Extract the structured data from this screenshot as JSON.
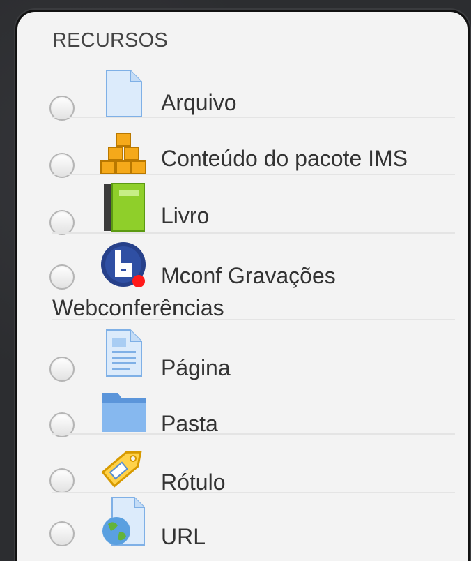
{
  "section": {
    "heading": "RECURSOS"
  },
  "options": [
    {
      "label": "Arquivo",
      "icon": "file-icon"
    },
    {
      "label": "Conteúdo do pacote IMS",
      "icon": "ims-package-icon"
    },
    {
      "label": "Livro",
      "icon": "book-icon"
    },
    {
      "label": "Mconf Gravações",
      "label_continued": "Webconferências",
      "icon": "bigbluebutton-icon"
    },
    {
      "label": "Página",
      "icon": "page-icon"
    },
    {
      "label": "Pasta",
      "icon": "folder-icon"
    },
    {
      "label": "Rótulo",
      "icon": "label-tag-icon"
    },
    {
      "label": "URL",
      "icon": "url-globe-icon"
    }
  ],
  "colors": {
    "panel": "#f3f3f3",
    "text": "#333333",
    "book_green": "#8fcf2a",
    "ims_orange": "#f5a91a",
    "folder_blue": "#6ea6e6"
  }
}
